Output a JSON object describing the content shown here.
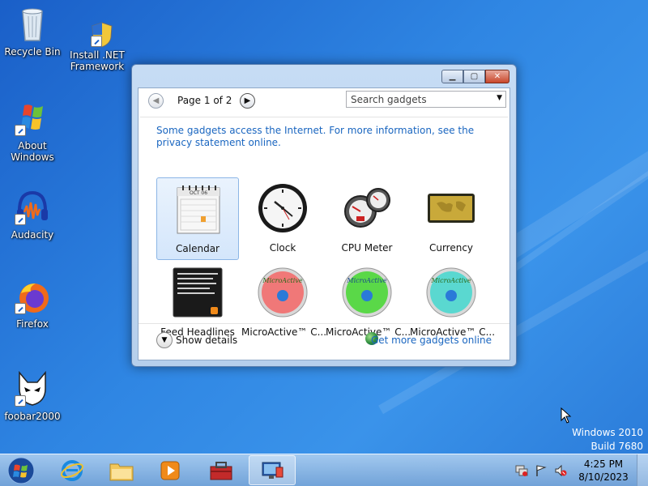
{
  "desktop": {
    "icons": [
      {
        "label": "Recycle Bin",
        "icon": "recycle-bin-icon"
      },
      {
        "label": "Install .NET Framework",
        "icon": "shield-icon"
      },
      {
        "label": "About Windows",
        "icon": "windows-flag-icon"
      },
      {
        "label": "Audacity",
        "icon": "audacity-icon"
      },
      {
        "label": "Firefox",
        "icon": "firefox-icon"
      },
      {
        "label": "foobar2000",
        "icon": "foobar2000-icon"
      }
    ],
    "watermark": {
      "line1": "Windows 2010",
      "line2": "Build 7680"
    }
  },
  "gadgets_window": {
    "pager": {
      "label": "Page 1 of 2"
    },
    "search": {
      "value": "Search gadgets"
    },
    "notice": "Some gadgets access the Internet.  For more information, see the privacy statement online.",
    "gadgets": [
      {
        "label": "Calendar",
        "icon": "calendar-icon",
        "selected": true,
        "month": "OCT 06"
      },
      {
        "label": "Clock",
        "icon": "clock-icon"
      },
      {
        "label": "CPU Meter",
        "icon": "cpu-meter-icon"
      },
      {
        "label": "Currency",
        "icon": "currency-icon"
      },
      {
        "label": "Feed Headlines",
        "icon": "feed-headlines-icon"
      },
      {
        "label": "MicroActive™ C...",
        "icon": "microactive-red-icon",
        "logo_text": "MicroActive"
      },
      {
        "label": "MicroActive™ C...",
        "icon": "microactive-green-icon",
        "logo_text": "MicroActive"
      },
      {
        "label": "MicroActive™ C...",
        "icon": "microactive-cyan-icon",
        "logo_text": "MicroActive"
      }
    ],
    "footer": {
      "details_label": "Show details",
      "online_link": "Get more gadgets online"
    }
  },
  "taskbar": {
    "items": [
      {
        "icon": "start-orb-icon"
      },
      {
        "icon": "internet-explorer-icon"
      },
      {
        "icon": "file-explorer-icon"
      },
      {
        "icon": "media-player-icon"
      },
      {
        "icon": "toolbox-icon"
      },
      {
        "icon": "gadgets-app-icon",
        "active": true
      }
    ],
    "clock": {
      "time": "4:25 PM",
      "date": "8/10/2023"
    }
  }
}
